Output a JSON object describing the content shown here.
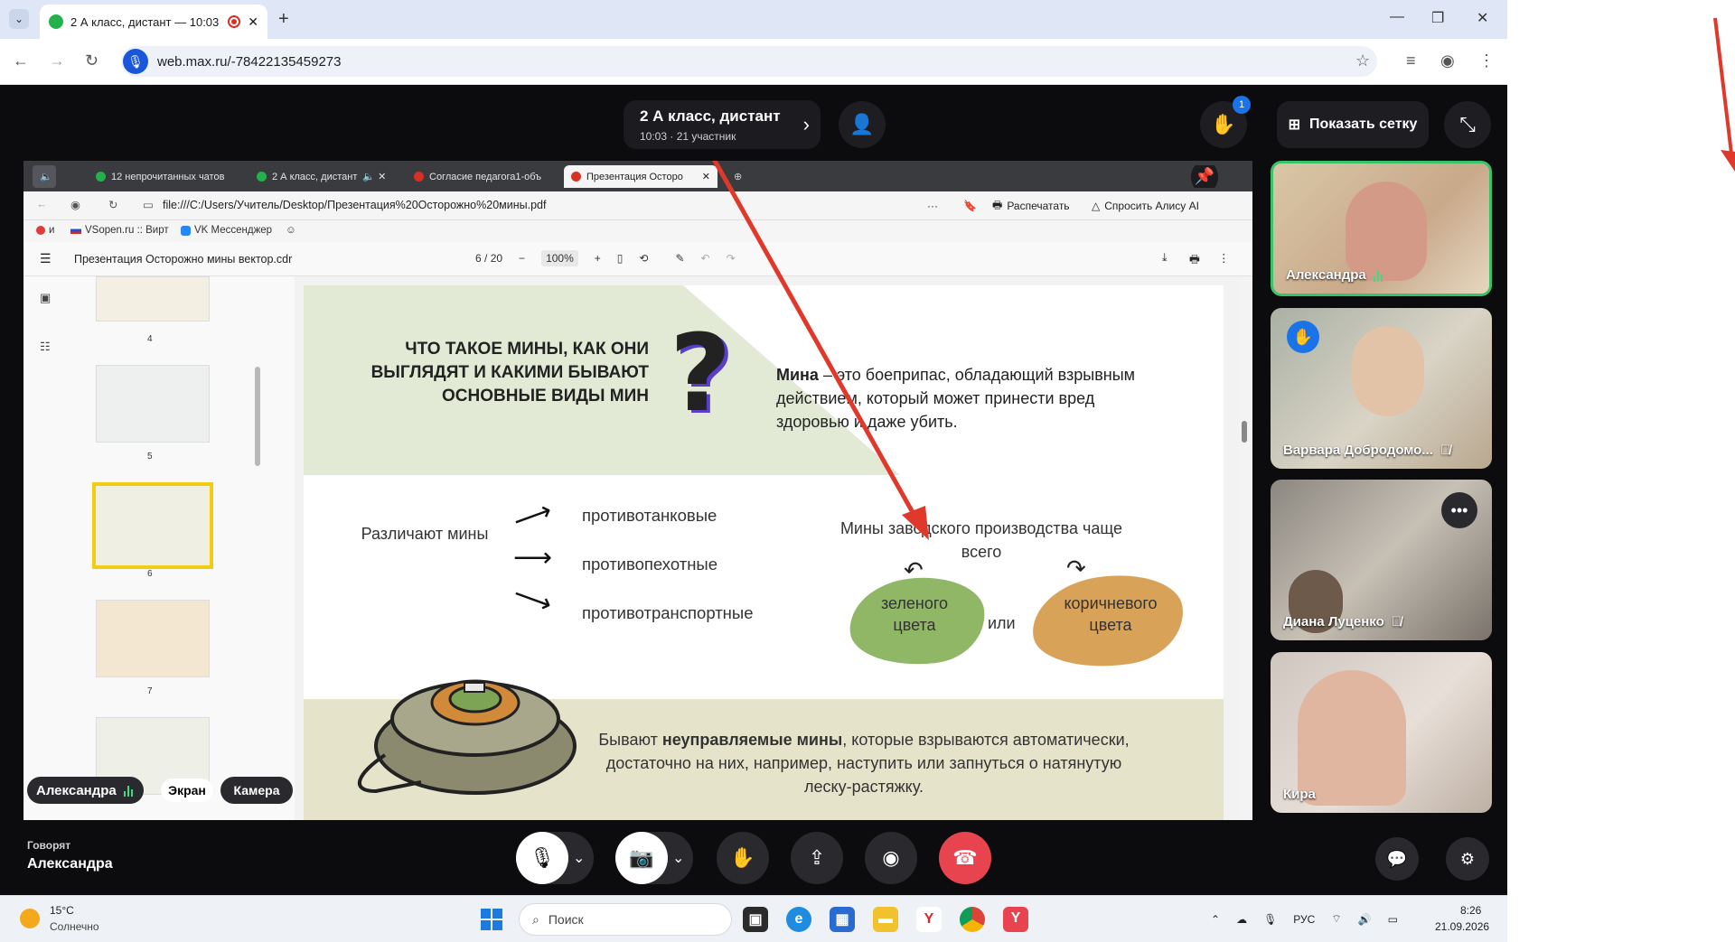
{
  "browser": {
    "tab_title": "2 А класс, дистант — 10:03",
    "url": "web.max.ru/-78422135459273"
  },
  "call": {
    "title": "2 А класс, дистант",
    "subtitle": "10:03 · 21 участник",
    "raised_hands_count": "1",
    "grid_button": "Показать сетку",
    "speaking_label": "Говорят",
    "speaking_name": "Александра"
  },
  "shared": {
    "inner_tabs": [
      {
        "label": "12 непрочитанных чатов"
      },
      {
        "label": "2 А класс, дистант"
      },
      {
        "label": "Согласие педагога1-объ"
      },
      {
        "label": "Презентация Осторо"
      }
    ],
    "inner_url": "file:///C:/Users/Учитель/Desktop/Презентация%20Осторожно%20мины.pdf",
    "print_label": "Распечатать",
    "alice_label": "Спросить Алису AI",
    "bookmarks": [
      {
        "label": "и"
      },
      {
        "label": "VSopen.ru :: Вирт"
      },
      {
        "label": "VK Мессенджер"
      }
    ],
    "pdf_title": "Презентация Осторожно мины вектор.cdr",
    "page_current": "6",
    "page_total": "/ 20",
    "zoom": "100%",
    "thumb_numbers": [
      "4",
      "5",
      "6",
      "7"
    ],
    "slide": {
      "heading": "ЧТО ТАКОЕ МИНЫ, КАК ОНИ ВЫГЛЯДЯТ И КАКИМИ БЫВАЮТ ОСНОВНЫЕ ВИДЫ МИН",
      "def_bold": "Мина",
      "def_rest": " – это боеприпас, обладающий взрывным действием, который может принести вред здоровью и даже убить.",
      "kinds_label": "Различают мины",
      "kinds": [
        "противотанковые",
        "противопехотные",
        "противотранспортные"
      ],
      "factory_text": "Мины заводского производства чаще всего",
      "color_green": "зеленого цвета",
      "or_word": "или",
      "color_brown": "коричневого цвета",
      "bottom_pre": "Бывают ",
      "bottom_bold": "неуправляемые мины",
      "bottom_post": ", которые взрываются автоматически, достаточно на них, например, наступить или запнуться о натянутую леску-растяжку."
    },
    "presenter_name": "Александра",
    "screen_label": "Экран",
    "camera_label": "Камера"
  },
  "participants": [
    {
      "name": "Александра",
      "status": "speaking"
    },
    {
      "name": "Варвара Добродомо...",
      "status": "muted-hand-raised"
    },
    {
      "name": "Диана Луценко",
      "status": "muted"
    },
    {
      "name": "Кира",
      "status": ""
    }
  ],
  "taskbar": {
    "temperature": "15°C",
    "weather": "Солнечно",
    "search_placeholder": "Поиск",
    "language": "РУС",
    "time": "8:26",
    "date": "21.09.2026"
  },
  "colors": {
    "call_bg": "#0c0c0e",
    "end_call": "#e8444f",
    "highlight_yellow": "#f0cd13",
    "annotation_arrow": "#e0392b"
  }
}
